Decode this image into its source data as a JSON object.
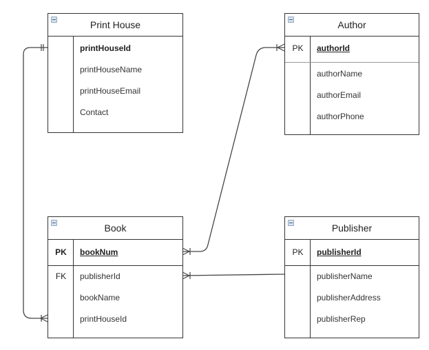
{
  "diagram": {
    "type": "ER diagram",
    "entities": {
      "print_house": {
        "title": "Print House",
        "rows": [
          {
            "key": "",
            "field": "printHouseId",
            "primary": true
          },
          {
            "key": "",
            "field": "printHouseName"
          },
          {
            "key": "",
            "field": "printHouseEmail"
          },
          {
            "key": "",
            "field": "Contact"
          }
        ]
      },
      "author": {
        "title": "Author",
        "rows": [
          {
            "key": "PK",
            "field": "authorId",
            "primary": true
          },
          {
            "key": "",
            "field": "authorName"
          },
          {
            "key": "",
            "field": "authorEmail"
          },
          {
            "key": "",
            "field": "authorPhone"
          }
        ]
      },
      "book": {
        "title": "Book",
        "rows": [
          {
            "key": "PK",
            "field": "bookNum",
            "primary": true
          },
          {
            "key": "FK",
            "field": "publisherId"
          },
          {
            "key": "",
            "field": "bookName"
          },
          {
            "key": "",
            "field": "printHouseId"
          }
        ]
      },
      "publisher": {
        "title": "Publisher",
        "rows": [
          {
            "key": "PK",
            "field": "publisherId",
            "primary": true
          },
          {
            "key": "",
            "field": "publisherName"
          },
          {
            "key": "",
            "field": "publisherAddress"
          },
          {
            "key": "",
            "field": "publisherRep"
          }
        ]
      }
    },
    "relationships": [
      {
        "from": "Print House.printHouseId",
        "to": "Book.printHouseId",
        "from_cardinality": "one-and-only-one",
        "to_cardinality": "one-or-many"
      },
      {
        "from": "Book.bookNum",
        "to": "Author.authorId",
        "from_cardinality": "one-or-many",
        "to_cardinality": "one-or-many"
      },
      {
        "from": "Book.publisherId",
        "to": "Publisher",
        "from_cardinality": "one-or-many",
        "to_cardinality": "none"
      }
    ],
    "colors": {
      "line": "#333333",
      "collapse_icon": "#d8e2ee"
    }
  }
}
